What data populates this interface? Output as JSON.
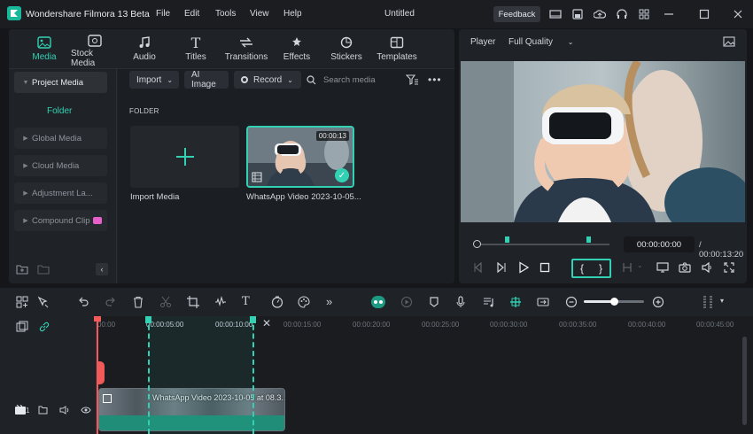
{
  "app": {
    "title": "Wondershare Filmora 13 Beta",
    "document_title": "Untitled",
    "feedback_label": "Feedback",
    "accent": "#33d1b4"
  },
  "menu": [
    "File",
    "Edit",
    "Tools",
    "View",
    "Help"
  ],
  "tabs": [
    {
      "label": "Media",
      "icon": "media-icon",
      "active": true
    },
    {
      "label": "Stock Media",
      "icon": "stock-media-icon"
    },
    {
      "label": "Audio",
      "icon": "music-note-icon"
    },
    {
      "label": "Titles",
      "icon": "text-t-icon"
    },
    {
      "label": "Transitions",
      "icon": "transitions-icon"
    },
    {
      "label": "Effects",
      "icon": "effects-icon"
    },
    {
      "label": "Stickers",
      "icon": "stickers-icon"
    },
    {
      "label": "Templates",
      "icon": "templates-icon"
    }
  ],
  "sidebar": {
    "items": [
      {
        "label": "Project Media",
        "active": true
      },
      {
        "label": "Folder"
      },
      {
        "label": "Global Media"
      },
      {
        "label": "Cloud Media"
      },
      {
        "label": "Adjustment La..."
      },
      {
        "label": "Compound Clip"
      }
    ]
  },
  "media_toolbar": {
    "import": "Import",
    "ai_image": "AI Image",
    "record": "Record",
    "search_placeholder": "Search media"
  },
  "media": {
    "section": "FOLDER",
    "import_label": "Import Media",
    "clip": {
      "name": "WhatsApp Video 2023-10-05...",
      "duration": "00:00:13"
    }
  },
  "player": {
    "label": "Player",
    "quality": "Full Quality",
    "current_time": "00:00:00:00",
    "total_time": "/ 00:00:13:20"
  },
  "timeline": {
    "ruler": [
      "00:00",
      "00:00:05:00",
      "00:00:10:00",
      "00:00:15:00",
      "00:00:20:00",
      "00:00:25:00",
      "00:00:30:00",
      "00:00:35:00",
      "00:00:40:00",
      "00:00:45:00"
    ],
    "clip_label": "WhatsApp Video 2023-10-05 at 08.3...4b2f4",
    "track_number": "1"
  }
}
